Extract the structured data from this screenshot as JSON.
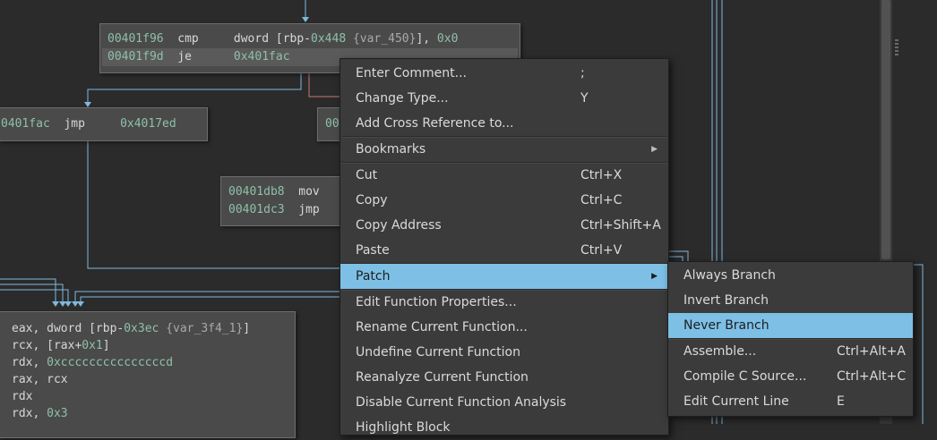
{
  "graph": {
    "block_top": [
      {
        "addr": "00401f96",
        "mn": "cmp",
        "op1": "dword [",
        "reg": "rbp-",
        "num": "0x448",
        "var": " {var_450}",
        "op2": "], ",
        "imm": "0x0"
      },
      {
        "addr": "00401f9d",
        "mn": "je",
        "target": "0x401fac"
      }
    ],
    "block_left": {
      "addr": "0401fac",
      "mn": "jmp",
      "target": "0x4017ed"
    },
    "block_mid_peek": "00",
    "block_mid": [
      {
        "addr": "00401db8",
        "mn": "mov"
      },
      {
        "addr": "00401dc3",
        "mn": "jmp"
      }
    ],
    "block_bottom": [
      {
        "reg": "eax",
        "rest": ", dword [rbp-",
        "num": "0x3ec",
        "var": " {var_3f4_1}",
        "tail": "]"
      },
      {
        "reg": "rcx",
        "rest": ", [rax+",
        "num": "0x1",
        "tail": "]"
      },
      {
        "reg": "rdx",
        "rest": ", ",
        "num": "0xcccccccccccccccd",
        "tail": ""
      },
      {
        "reg": "rax",
        "rest": ", rcx",
        "num": "",
        "tail": ""
      },
      {
        "reg": "rdx",
        "rest": "",
        "num": "",
        "tail": ""
      },
      {
        "reg": "rdx",
        "rest": ", ",
        "num": "0x3",
        "tail": ""
      }
    ]
  },
  "context_menu": {
    "items": [
      {
        "label": "Enter Comment...",
        "shortcut": ";"
      },
      {
        "label": "Change Type...",
        "shortcut": "Y"
      },
      {
        "label": "Add Cross Reference to...",
        "shortcut": ""
      },
      {
        "label": "Bookmarks",
        "shortcut": "",
        "submenu": true
      },
      {
        "label": "Cut",
        "shortcut": "Ctrl+X"
      },
      {
        "label": "Copy",
        "shortcut": "Ctrl+C"
      },
      {
        "label": "Copy Address",
        "shortcut": "Ctrl+Shift+A"
      },
      {
        "label": "Paste",
        "shortcut": "Ctrl+V"
      },
      {
        "label": "Patch",
        "shortcut": "",
        "submenu": true,
        "active": true
      },
      {
        "label": "Edit Function Properties...",
        "shortcut": ""
      },
      {
        "label": "Rename Current Function...",
        "shortcut": ""
      },
      {
        "label": "Undefine Current Function",
        "shortcut": ""
      },
      {
        "label": "Reanalyze Current Function",
        "shortcut": ""
      },
      {
        "label": "Disable Current Function Analysis",
        "shortcut": ""
      },
      {
        "label": "Highlight Block",
        "shortcut": ""
      }
    ]
  },
  "patch_submenu": {
    "items": [
      {
        "label": "Always Branch",
        "shortcut": ""
      },
      {
        "label": "Invert Branch",
        "shortcut": ""
      },
      {
        "label": "Never Branch",
        "shortcut": "",
        "active": true
      },
      {
        "label": "Assemble...",
        "shortcut": "Ctrl+Alt+A"
      },
      {
        "label": "Compile C Source...",
        "shortcut": "Ctrl+Alt+C"
      },
      {
        "label": "Edit Current Line",
        "shortcut": "E"
      }
    ]
  },
  "colors": {
    "accent": "#7ebfe6",
    "wire_blue": "#7fb8dc",
    "wire_red": "#c97a7a",
    "bg": "#2b2b2b"
  }
}
